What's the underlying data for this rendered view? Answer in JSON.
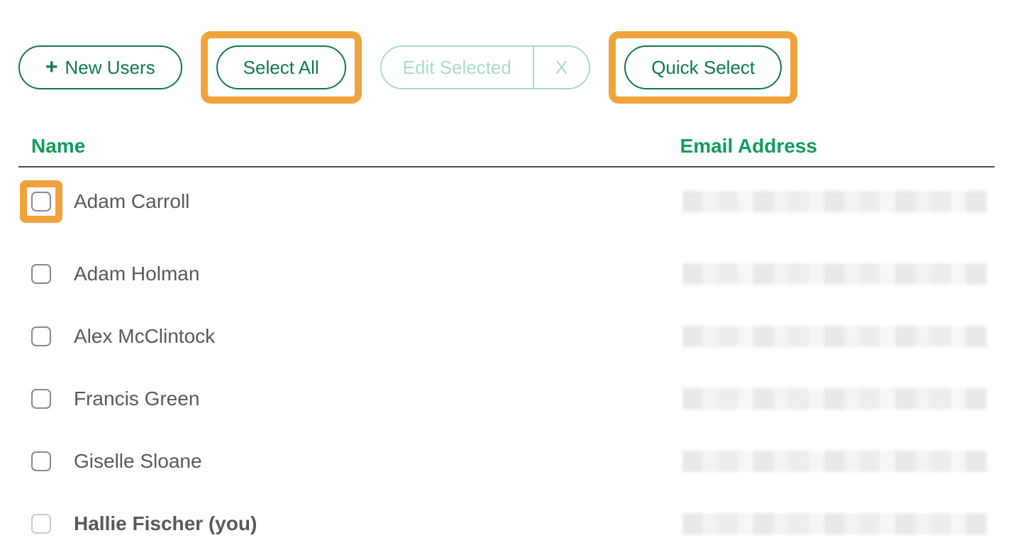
{
  "buttons": {
    "new_users": "New Users",
    "select_all": "Select All",
    "edit_selected": "Edit Selected",
    "close": "X",
    "quick_select": "Quick Select"
  },
  "columns": {
    "name": "Name",
    "email": "Email Address"
  },
  "rows": [
    {
      "name": "Adam Carroll",
      "bold": false,
      "dim": false,
      "highlight": true
    },
    {
      "name": "Adam Holman",
      "bold": false,
      "dim": false,
      "highlight": false
    },
    {
      "name": "Alex McClintock",
      "bold": false,
      "dim": false,
      "highlight": false
    },
    {
      "name": "Francis Green",
      "bold": false,
      "dim": false,
      "highlight": false
    },
    {
      "name": "Giselle Sloane",
      "bold": false,
      "dim": false,
      "highlight": false
    },
    {
      "name": "Hallie Fischer (you)",
      "bold": true,
      "dim": true,
      "highlight": false
    }
  ]
}
